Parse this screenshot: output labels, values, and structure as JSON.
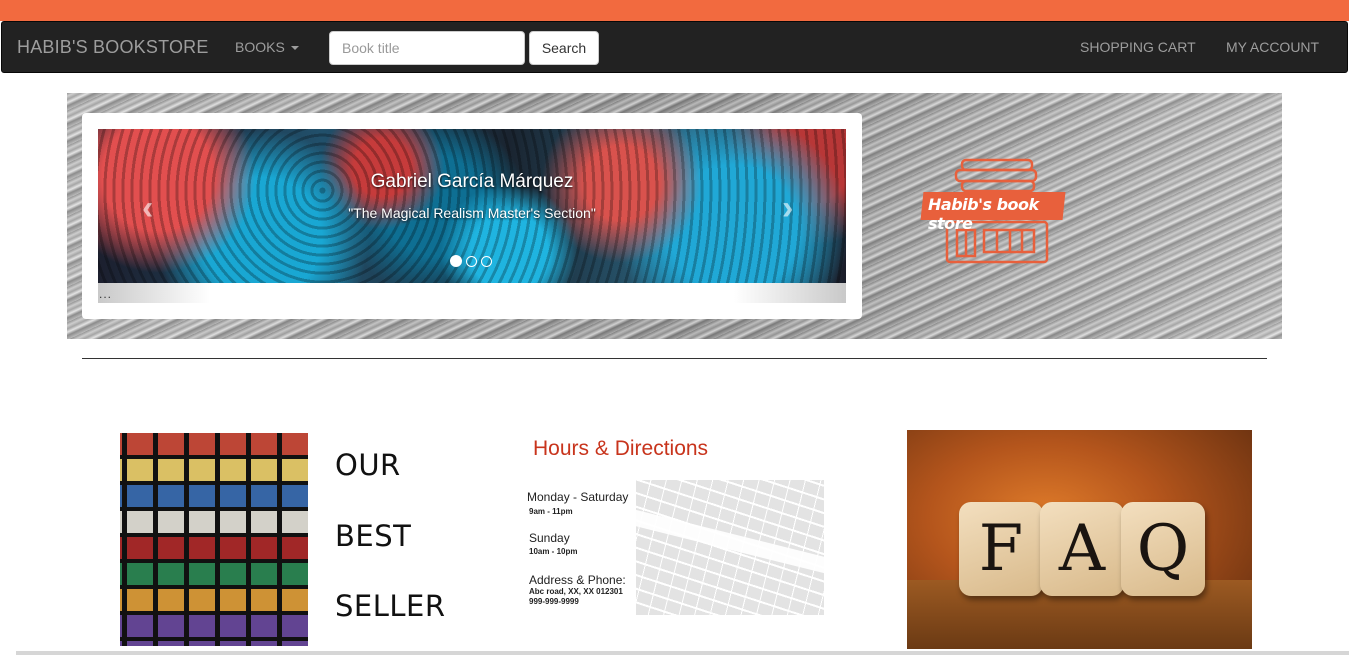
{
  "navbar": {
    "brand": "HABIB'S BOOKSTORE",
    "books_label": "BOOKS",
    "search_placeholder": "Book title",
    "search_button": "Search",
    "cart_label": "SHOPPING CART",
    "account_label": "MY ACCOUNT"
  },
  "carousel": {
    "title": "Gabriel García Márquez",
    "subtitle": "\"The Magical Realism Master's Section\"",
    "prev_icon": "‹",
    "next_icon": "›",
    "ellipsis": "...",
    "active_slide": 1,
    "total_slides": 3
  },
  "logo": {
    "text": "Habib's book store"
  },
  "best_seller": {
    "line1": "OUR",
    "line2": "BEST",
    "line3": "SELLER"
  },
  "hours": {
    "title": "Hours & Directions",
    "weekday_label": "Monday - Saturday",
    "weekday_hours": "9am - 11pm",
    "sunday_label": "Sunday",
    "sunday_hours": "10am - 10pm",
    "address_label": "Address & Phone:",
    "address": "Abc road, XX, XX 012301",
    "phone": "999-999-9999"
  },
  "faq": {
    "letters": [
      "F",
      "A",
      "Q"
    ]
  },
  "colors": {
    "accent_stripe": "#f26a3f",
    "navbar_bg": "#222222",
    "hours_title": "#c8341c",
    "logo_orange": "#e8603c"
  }
}
